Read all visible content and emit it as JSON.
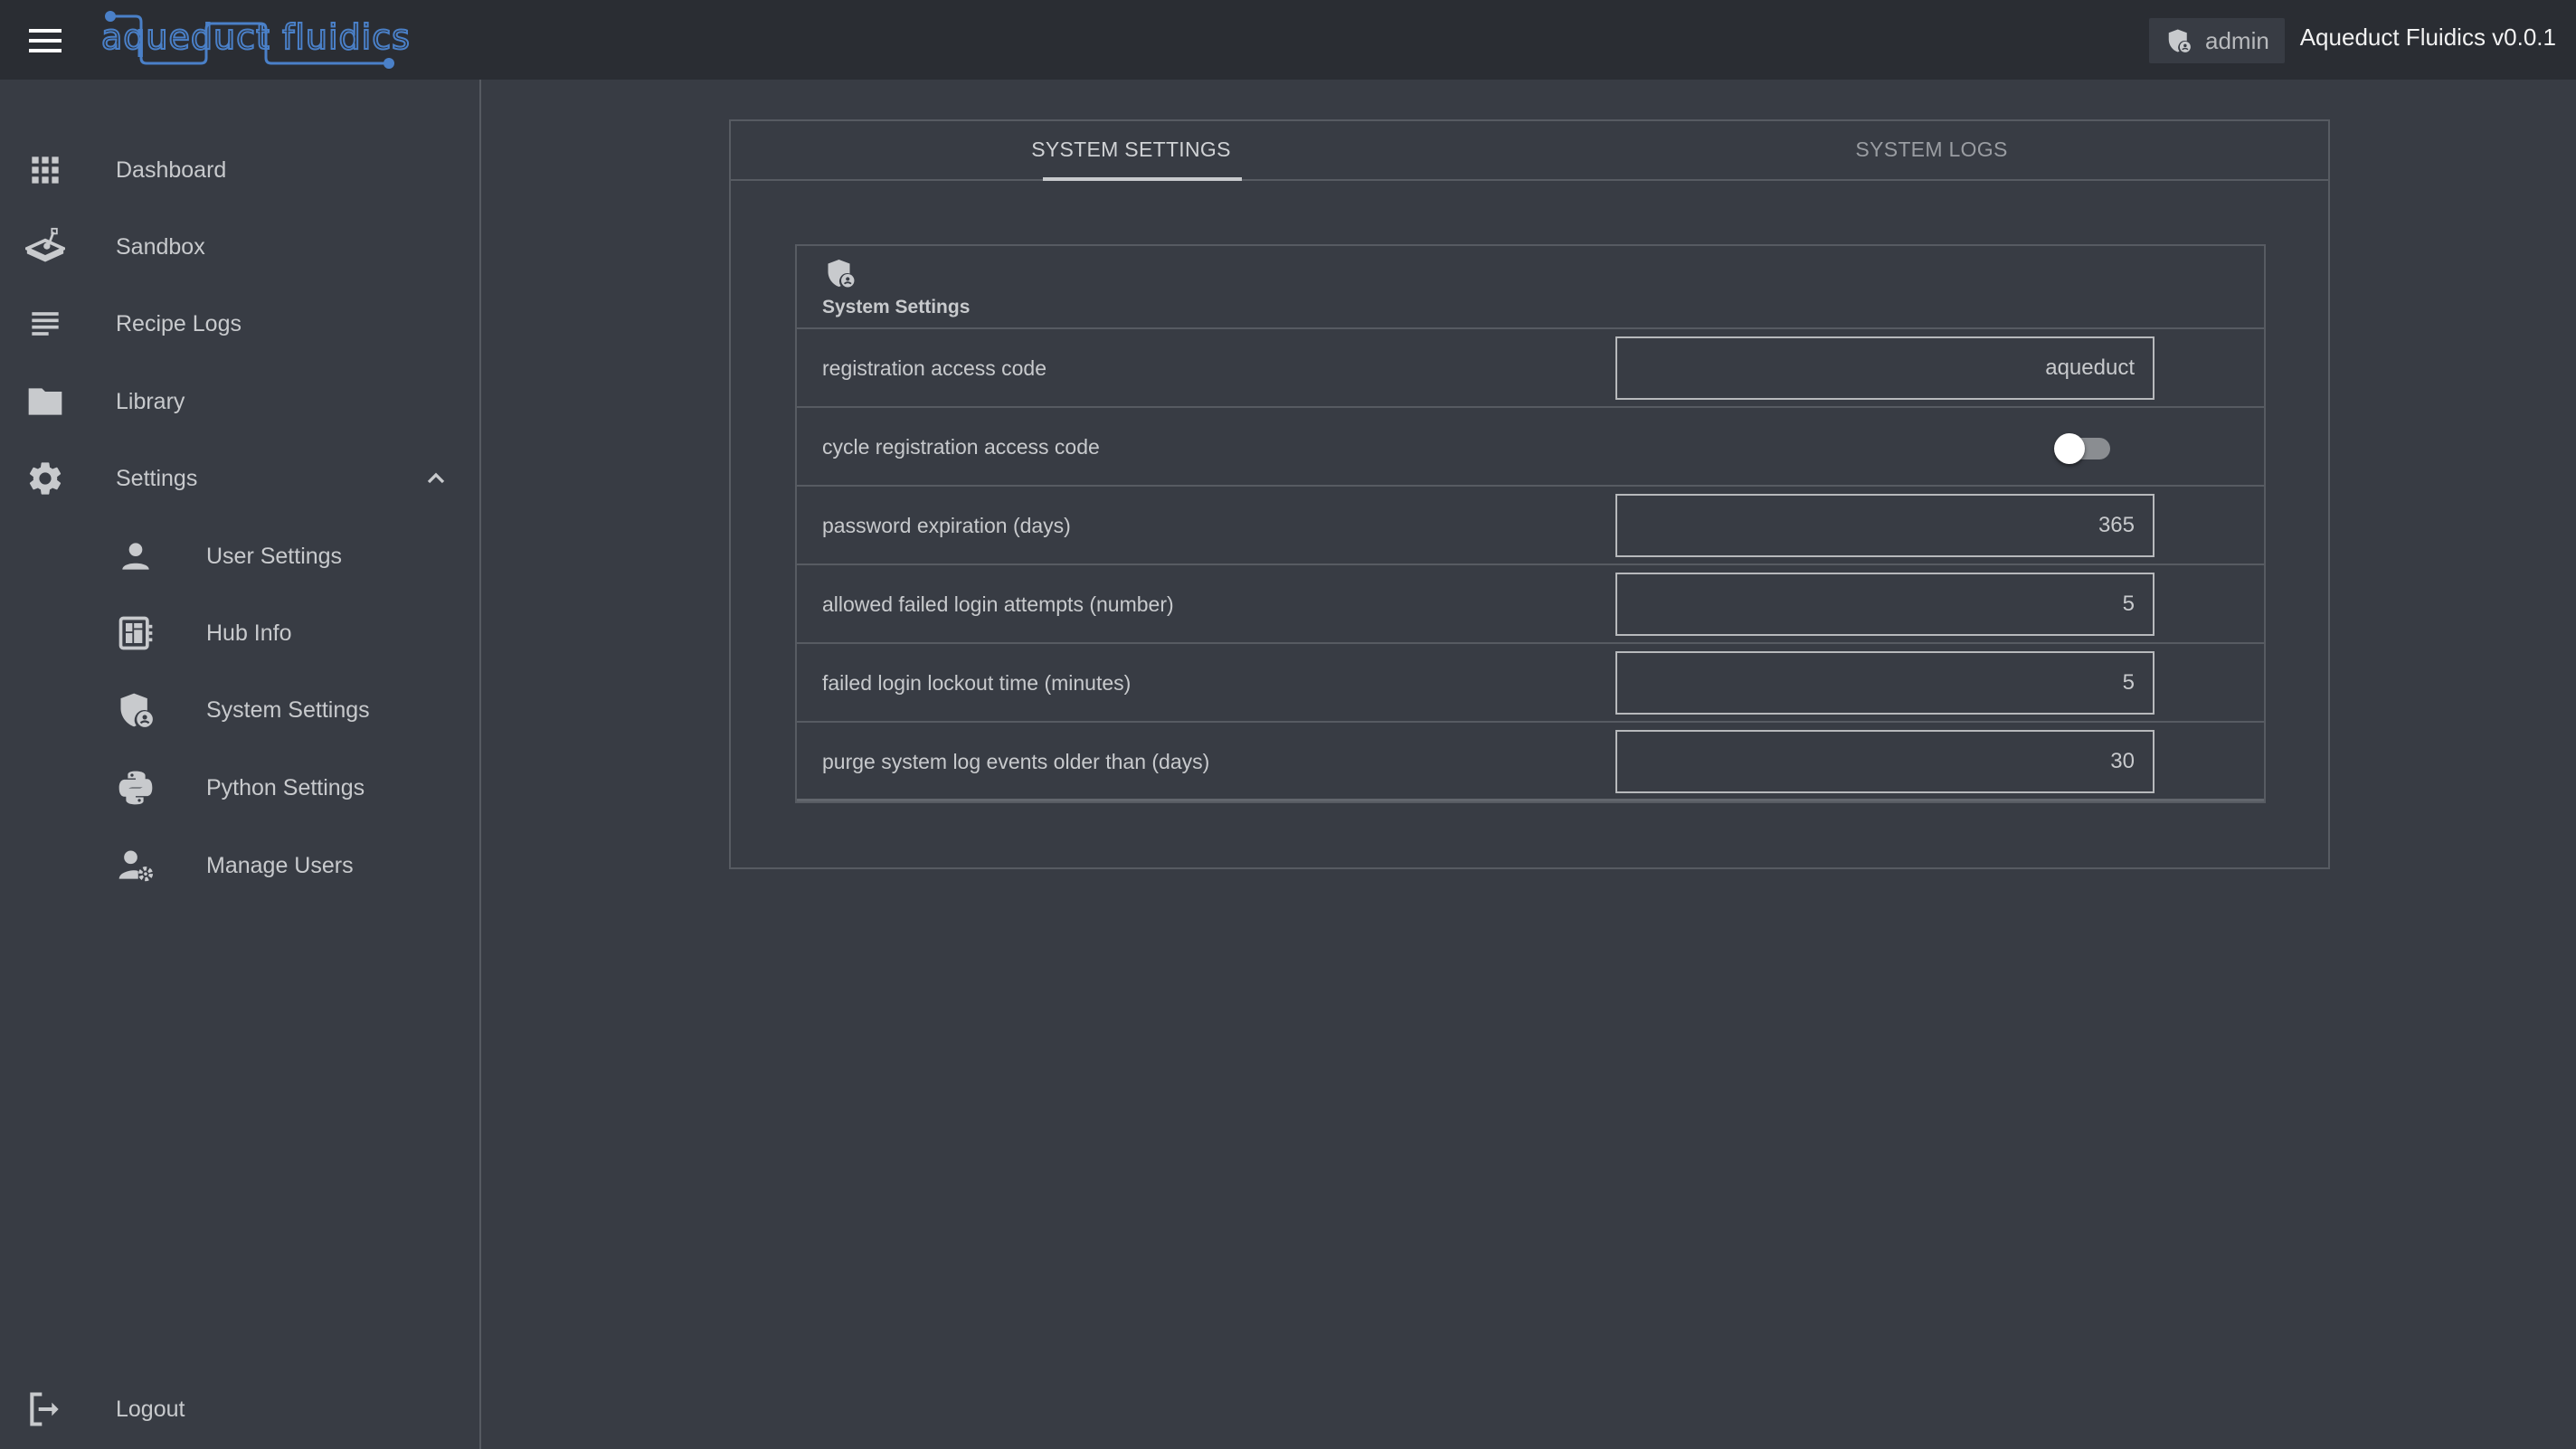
{
  "header": {
    "menu_icon": "hamburger-menu-icon",
    "logo_text": "aqueduct fluidics",
    "user_chip": {
      "icon": "admin-shield-user-icon",
      "label": "admin"
    },
    "version": "Aqueduct Fluidics v0.0.1",
    "colors": {
      "background": "#2a2d33",
      "logo": "#4a80c8"
    }
  },
  "sidebar": {
    "items": [
      {
        "label": "Dashboard",
        "icon": "apps-grid-icon"
      },
      {
        "label": "Sandbox",
        "icon": "sandbox-icon"
      },
      {
        "label": "Recipe Logs",
        "icon": "notes-lines-icon"
      },
      {
        "label": "Library",
        "icon": "folder-icon"
      },
      {
        "label": "Settings",
        "icon": "gear-icon",
        "expanded": true,
        "chevron": "chevron-up-icon"
      }
    ],
    "settings_children": [
      {
        "label": "User Settings",
        "icon": "person-icon"
      },
      {
        "label": "Hub Info",
        "icon": "hub-board-icon"
      },
      {
        "label": "System Settings",
        "icon": "admin-shield-user-icon",
        "active": true
      },
      {
        "label": "Python Settings",
        "icon": "python-icon"
      },
      {
        "label": "Manage Users",
        "icon": "manage-users-icon"
      }
    ],
    "logout": {
      "label": "Logout",
      "icon": "logout-icon"
    }
  },
  "main": {
    "tabs": [
      {
        "label": "SYSTEM SETTINGS",
        "active": true
      },
      {
        "label": "SYSTEM LOGS",
        "active": false
      }
    ],
    "card": {
      "title": "System Settings",
      "icon": "admin-shield-user-icon",
      "rows": [
        {
          "label": "registration access code",
          "type": "text",
          "value": "aqueduct"
        },
        {
          "label": "cycle registration access code",
          "type": "toggle",
          "checked": false
        },
        {
          "label": "password expiration (days)",
          "type": "number",
          "value": "365"
        },
        {
          "label": "allowed failed login attempts (number)",
          "type": "number",
          "value": "5"
        },
        {
          "label": "failed login lockout time (minutes)",
          "type": "number",
          "value": "5"
        },
        {
          "label": "purge system log events older than (days)",
          "type": "number",
          "value": "30"
        }
      ]
    }
  }
}
